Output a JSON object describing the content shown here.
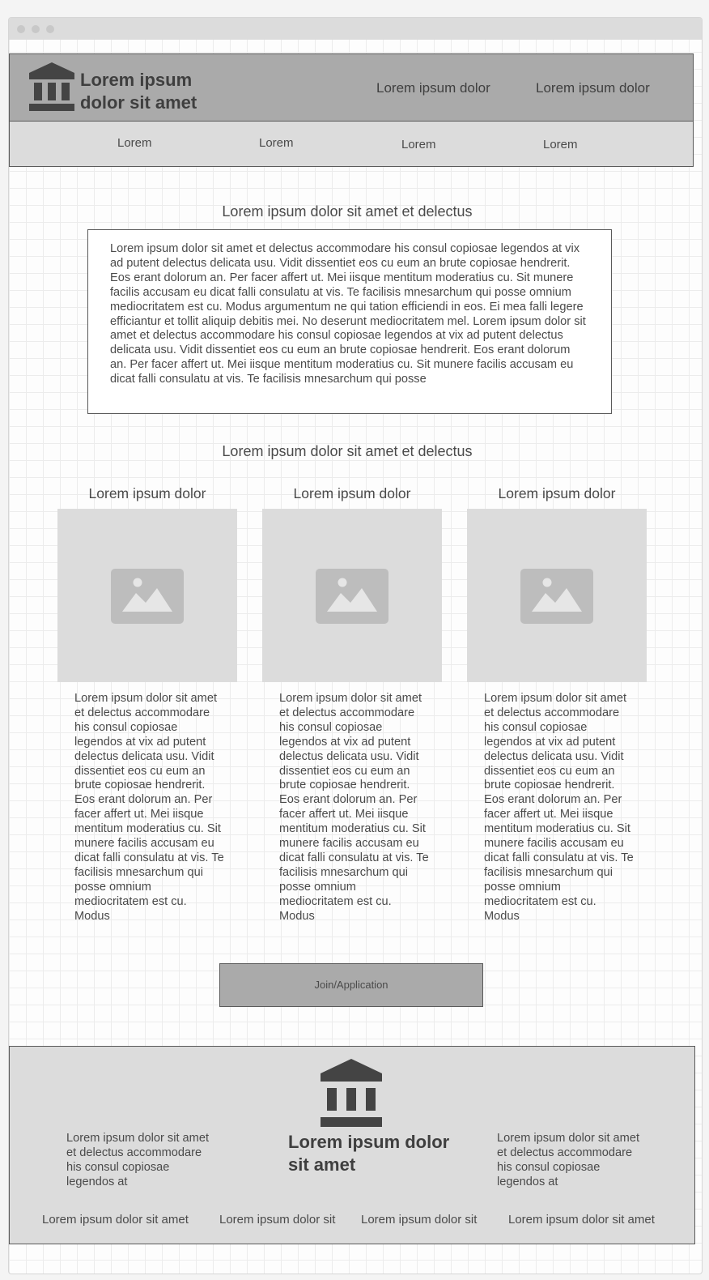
{
  "header": {
    "brand": "Lorem ipsum dolor sit amet",
    "links": [
      "Lorem ipsum dolor",
      "Lorem ipsum dolor"
    ]
  },
  "subnav": {
    "items": [
      "Lorem",
      "Lorem",
      "Lorem",
      "Lorem"
    ]
  },
  "intro": {
    "title": "Lorem ipsum dolor sit amet et delectus",
    "body": "Lorem ipsum dolor sit amet et delectus accommodare his consul copiosae legendos at vix ad putent delectus delicata usu. Vidit dissentiet eos cu eum an brute copiosae hendrerit. Eos erant dolorum an. Per facer affert ut. Mei iisque mentitum moderatius cu. Sit munere facilis accusam eu dicat falli consulatu at vis. Te facilisis mnesarchum qui posse omnium mediocritatem est cu. Modus argumentum ne qui tation efficiendi in eos. Ei mea falli legere efficiantur et tollit aliquip debitis mei. No deserunt mediocritatem mel. Lorem ipsum dolor sit amet et delectus accommodare his consul copiosae legendos at vix ad putent delectus delicata usu. Vidit dissentiet eos cu eum an brute copiosae hendrerit. Eos erant dolorum an. Per facer affert ut. Mei iisque mentitum moderatius cu. Sit munere facilis accusam eu dicat falli consulatu at vis. Te facilisis mnesarchum qui posse"
  },
  "features": {
    "title": "Lorem ipsum dolor sit amet et delectus",
    "columns": [
      {
        "title": "Lorem ipsum dolor",
        "text": "Lorem ipsum dolor sit amet et delectus accommodare his consul copiosae legendos at vix ad putent delectus delicata usu. Vidit dissentiet eos cu eum an brute copiosae hendrerit. Eos erant dolorum an. Per facer affert ut. Mei iisque mentitum moderatius cu. Sit munere facilis accusam eu dicat falli consulatu at vis. Te facilisis mnesarchum qui posse omnium mediocritatem est cu. Modus"
      },
      {
        "title": "Lorem ipsum dolor",
        "text": "Lorem ipsum dolor sit amet et delectus accommodare his consul copiosae legendos at vix ad putent delectus delicata usu. Vidit dissentiet eos cu eum an brute copiosae hendrerit. Eos erant dolorum an. Per facer affert ut. Mei iisque mentitum moderatius cu. Sit munere facilis accusam eu dicat falli consulatu at vis. Te facilisis mnesarchum qui posse omnium mediocritatem est cu. Modus"
      },
      {
        "title": "Lorem ipsum dolor",
        "text": "Lorem ipsum dolor sit amet et delectus accommodare his consul copiosae legendos at vix ad putent delectus delicata usu. Vidit dissentiet eos cu eum an brute copiosae hendrerit. Eos erant dolorum an. Per facer affert ut. Mei iisque mentitum moderatius cu. Sit munere facilis accusam eu dicat falli consulatu at vis. Te facilisis mnesarchum qui posse omnium mediocritatem est cu. Modus"
      }
    ]
  },
  "cta": {
    "label": "Join/Application"
  },
  "footer": {
    "brand": "Lorem ipsum dolor sit amet",
    "left_text": "Lorem ipsum dolor sit amet et delectus accommodare his consul copiosae legendos at",
    "right_text": "Lorem ipsum dolor sit amet et delectus accommodare his consul copiosae legendos at",
    "links": [
      "Lorem ipsum dolor sit amet",
      "Lorem ipsum dolor sit",
      "Lorem ipsum dolor sit",
      "Lorem ipsum dolor sit amet"
    ]
  },
  "colors": {
    "header_bg": "#aaaaaa",
    "subnav_bg": "#dcdcdc",
    "icon": "#444444",
    "placeholder_bg": "#dcdcdc",
    "placeholder_icon": "#bdbdbd"
  },
  "icons": {
    "logo": "bank-building-icon",
    "image_placeholder": "image-placeholder-icon"
  }
}
